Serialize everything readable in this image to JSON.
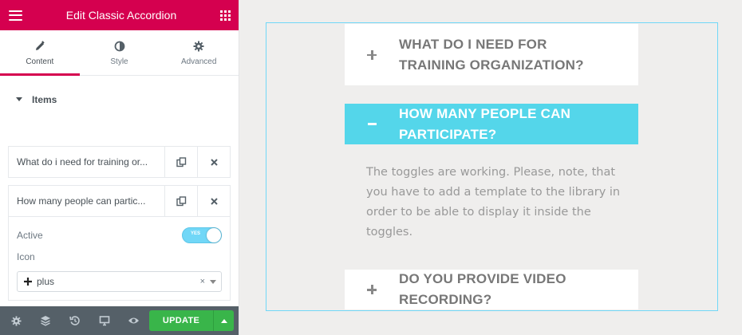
{
  "panel": {
    "title": "Edit Classic Accordion",
    "tabs": [
      {
        "label": "Content",
        "icon": "pencil-icon",
        "active": true
      },
      {
        "label": "Style",
        "icon": "half-circle-icon",
        "active": false
      },
      {
        "label": "Advanced",
        "icon": "gear-icon",
        "active": false
      }
    ],
    "section_title": "Items",
    "items": [
      {
        "title": "What do i need for training or..."
      },
      {
        "title": "How many people can partic..."
      }
    ],
    "active_label": "Active",
    "switch_text": "YES",
    "icon_label": "Icon",
    "icon_value": "plus",
    "clear_symbol": "×",
    "update_label": "UPDATE"
  },
  "accordion": {
    "items": [
      {
        "title": "WHAT DO I NEED FOR TRAINING ORGANIZATION?",
        "open": false
      },
      {
        "title": "HOW MANY PEOPLE CAN PARTICIPATE?",
        "open": true
      },
      {
        "title": "DO YOU PROVIDE VIDEO RECORDING?",
        "open": false
      }
    ],
    "body_text": "The toggles are working. Please, note, that you have to add a template to the library in order to be able to display it inside the toggles.",
    "active_color": "#54d6ea"
  },
  "colors": {
    "brand": "#d5004f",
    "update": "#39b54a",
    "footer": "#556068"
  }
}
